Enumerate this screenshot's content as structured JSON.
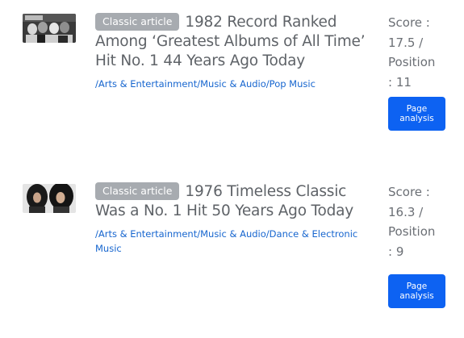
{
  "articles": [
    {
      "badge": "Classic article",
      "title": "1982 Record Ranked Among ‘Greatest Albums of All Time’ Hit No. 1 44 Years Ago Today",
      "category": "/Arts & Entertainment/Music & Audio/Pop Music",
      "score_label": "Score :",
      "score_value": "17.5 /",
      "position_label": "Position",
      "position_value": ": 11",
      "button_label": "Page analysis"
    },
    {
      "badge": "Classic article",
      "title": "1976 Timeless Classic Was a No. 1 Hit 50 Years Ago Today",
      "category": "/Arts & Entertainment/Music & Audio/Dance & Electronic Music",
      "score_label": "Score :",
      "score_value": "16.3 /",
      "position_label": "Position",
      "position_value": ": 9",
      "button_label": "Page analysis"
    }
  ]
}
